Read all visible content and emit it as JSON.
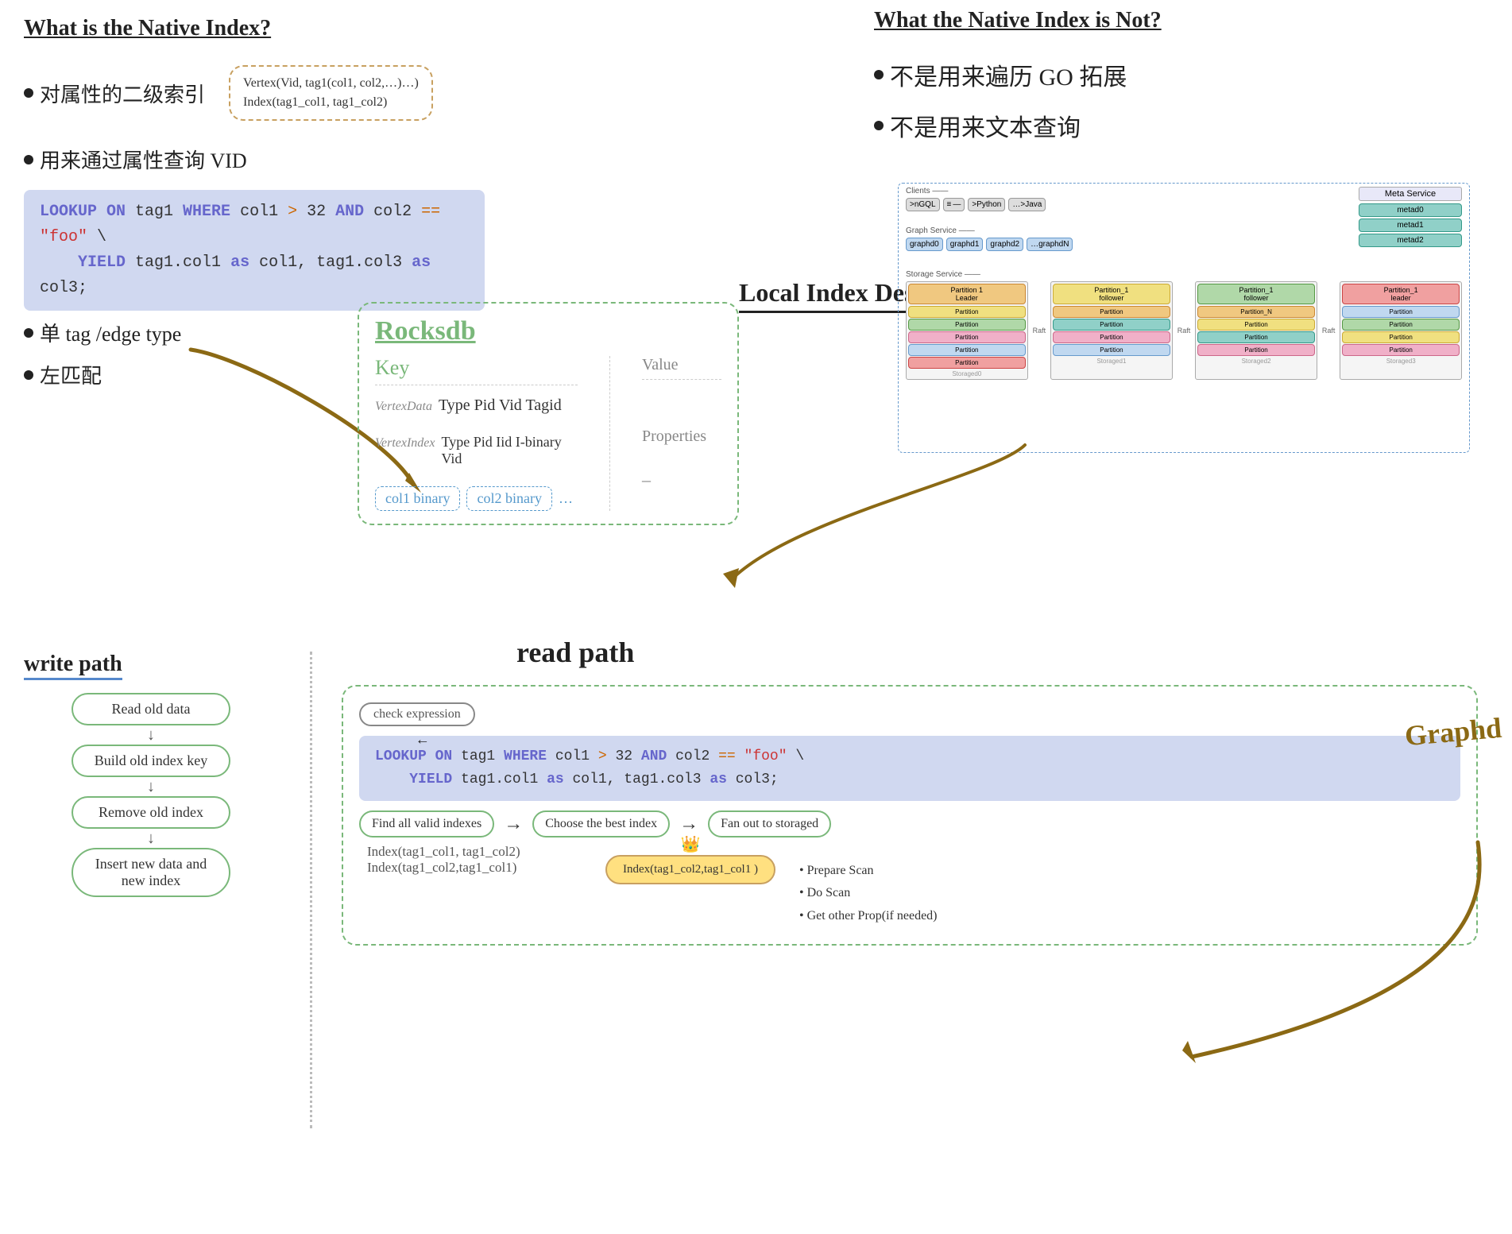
{
  "top_left": {
    "title": "What is the Native Index?",
    "bullets": [
      "对属性的二级索引",
      "用来通过属性查询 VID"
    ],
    "vertex_box_line1": "Vertex(Vid, tag1(col1, col2,…)…)",
    "vertex_box_line2": "Index(tag1_col1, tag1_col2)",
    "code_line1": "LOOKUP ON tag1 WHERE col1 > 32 AND col2 == \"foo\" \\",
    "code_line2": "    YIELD tag1.col1 as col1, tag1.col3 as col3;"
  },
  "top_right": {
    "title": "What the Native Index is Not?",
    "bullets": [
      "不是用来遍历 GO 拓展",
      "不是用来文本查询"
    ]
  },
  "local_index": {
    "title": "Local Index Design"
  },
  "rocksdb": {
    "title": "Rocksdb",
    "key_label": "Key",
    "value_label": "Value",
    "properties_label": "Properties",
    "vertex_data_label": "VertexData",
    "vertex_data_row": "Type  Pid  Vid  Tagid",
    "vertex_index_label": "VertexIndex",
    "vertex_index_row": "Type  Pid  Iid  I-binary  Vid",
    "vertex_index_dash": "–",
    "col_binary": "col1 binary    col2 binary  …"
  },
  "left_bullets": [
    "单 tag /edge type",
    "左匹配"
  ],
  "write_path": {
    "title": "write path",
    "steps": [
      "Read old data",
      "Build old index key",
      "Remove old index",
      "Insert new data and new index"
    ]
  },
  "read_path": {
    "title": "read path",
    "check_expression": "check expression",
    "code_line1": "LOOKUP ON tag1 WHERE col1 > 32 AND col2 == \"foo\" \\",
    "code_line2": "    YIELD tag1.col1 as col1, tag1.col3 as col3;",
    "find_indexes": "Find all valid indexes",
    "choose_index": "Choose the best index",
    "fan_out": "Fan out to storaged",
    "index1": "Index(tag1_col1, tag1_col2)",
    "index2": "Index(tag1_col2,tag1_col1)",
    "index_best": "Index(tag1_col2,tag1_col1 )",
    "scan_items": [
      "Prepare Scan",
      "Do Scan",
      "Get other Prop(if needed)"
    ],
    "graphd": "Graphd"
  }
}
